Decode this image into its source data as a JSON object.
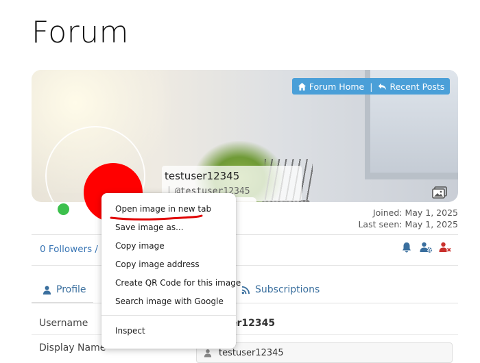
{
  "page": {
    "title": "Forum"
  },
  "nav": {
    "forum_home": "Forum Home",
    "separator": "|",
    "recent_posts": "Recent Posts"
  },
  "user": {
    "display": "testuser12345",
    "handle": "@testuser12345",
    "joined": "Joined: May 1, 2025",
    "last_seen": "Last seen: May 1, 2025",
    "followers": "0 Followers / 0 F"
  },
  "tabs": {
    "profile": "Profile",
    "subscriptions": "Subscriptions"
  },
  "fields": {
    "username_label": "Username",
    "username_value": "er12345",
    "display_name_label": "Display Name",
    "required_mark": "*",
    "display_name_value": "testuser12345"
  },
  "context_menu": {
    "items": [
      "Open image in new tab",
      "Save image as...",
      "Copy image",
      "Copy image address",
      "Create QR Code for this image",
      "Search image with Google",
      "Inspect"
    ]
  },
  "colors": {
    "accent": "#4a9fd8",
    "online": "#3cc04c",
    "avatar": "#ff0000",
    "annotation": "#e00000",
    "link": "#3a76b5"
  },
  "icons": {
    "home": "home-icon",
    "reply": "reply-icon",
    "image": "image-icon",
    "bell": "bell-icon",
    "user_settings": "user-settings-icon",
    "user_block": "user-block-icon",
    "user": "user-icon",
    "rss": "rss-icon"
  }
}
